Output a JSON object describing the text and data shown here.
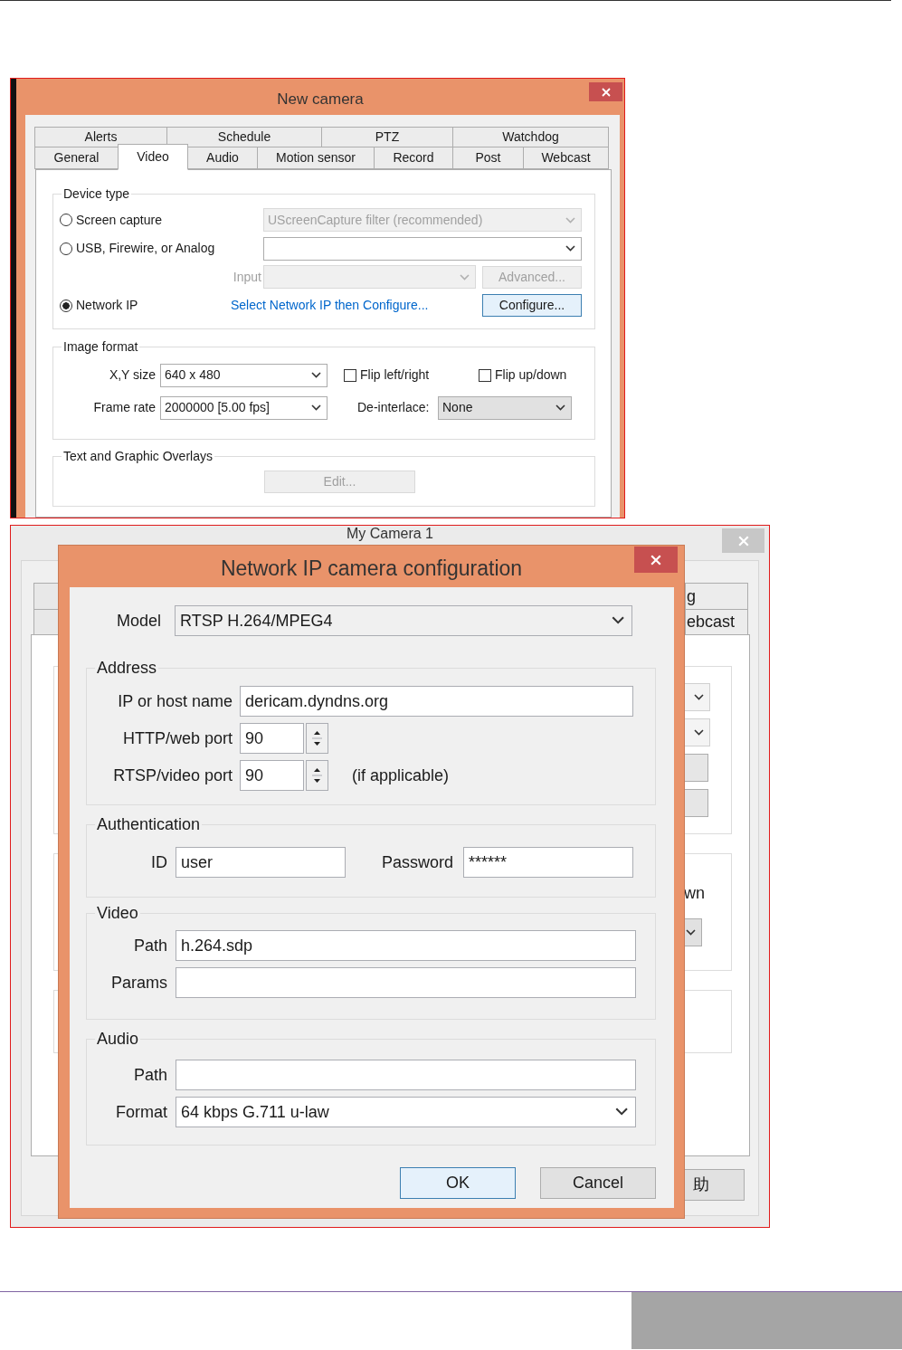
{
  "new_camera": {
    "title": "New camera",
    "tab_rows": [
      [
        {
          "label": "Alerts",
          "selected": false
        },
        {
          "label": "Schedule",
          "selected": false
        },
        {
          "label": "PTZ",
          "selected": false
        },
        {
          "label": "Watchdog",
          "selected": false
        }
      ],
      [
        {
          "label": "General",
          "selected": false
        },
        {
          "label": "Video",
          "selected": true
        },
        {
          "label": "Audio",
          "selected": false
        },
        {
          "label": "Motion sensor",
          "selected": false
        },
        {
          "label": "Record",
          "selected": false
        },
        {
          "label": "Post",
          "selected": false
        },
        {
          "label": "Webcast",
          "selected": false
        }
      ]
    ],
    "device_type": {
      "title": "Device type",
      "options": [
        {
          "label": "Screen capture",
          "selected": false
        },
        {
          "label": "USB, Firewire, or Analog",
          "selected": false
        },
        {
          "label": "Network IP",
          "selected": true
        }
      ],
      "screen_source": {
        "value": "UScreenCapture filter (recommended)",
        "disabled": true
      },
      "usb_source": {
        "disabled": false
      },
      "input": {
        "label": "Input",
        "disabled": true
      },
      "advanced_button": {
        "label": "Advanced...",
        "disabled": true
      },
      "network_link": "Select Network IP then Configure...",
      "configure_button": {
        "label": "Configure...",
        "disabled": false,
        "default": true
      }
    },
    "image_format": {
      "title": "Image format",
      "size": {
        "label": "X,Y size",
        "value": "640 x 480"
      },
      "flip_left_right": {
        "label": "Flip left/right",
        "checked": false
      },
      "flip_up_down": {
        "label": "Flip up/down",
        "checked": false
      },
      "frame_rate": {
        "label": "Frame rate",
        "value": "2000000 [5.00 fps]"
      },
      "deinterlace": {
        "label": "De-interlace:",
        "value": "None"
      }
    },
    "overlays": {
      "title": "Text and Graphic Overlays",
      "edit_button": {
        "label": "Edit...",
        "disabled": true
      }
    }
  },
  "my_camera": {
    "title": "My Camera 1",
    "tabs": [
      {
        "label": "g",
        "selected": false
      },
      {
        "label": "ebcast",
        "selected": false
      }
    ],
    "flip_label": "wn",
    "help_button": "助"
  },
  "ip_config": {
    "title": "Network IP camera configuration",
    "model": {
      "label": "Model",
      "value": "RTSP H.264/MPEG4"
    },
    "address": {
      "title": "Address",
      "host_label": "IP or host name",
      "host": "dericam.dyndns.org",
      "http_label": "HTTP/web port",
      "http_port": "90",
      "rtsp_label": "RTSP/video port",
      "rtsp_port": "90",
      "rtsp_note": "(if applicable)"
    },
    "authentication": {
      "title": "Authentication",
      "id_label": "ID",
      "id": "user",
      "password_label": "Password",
      "password": "******"
    },
    "video": {
      "title": "Video",
      "path_label": "Path",
      "path": "h.264.sdp",
      "params_label": "Params"
    },
    "audio": {
      "title": "Audio",
      "path_label": "Path",
      "format_label": "Format",
      "format": "64 kbps G.711 u-law"
    },
    "buttons": [
      {
        "label": "OK",
        "default": true
      },
      {
        "label": "Cancel",
        "default": false
      }
    ]
  }
}
